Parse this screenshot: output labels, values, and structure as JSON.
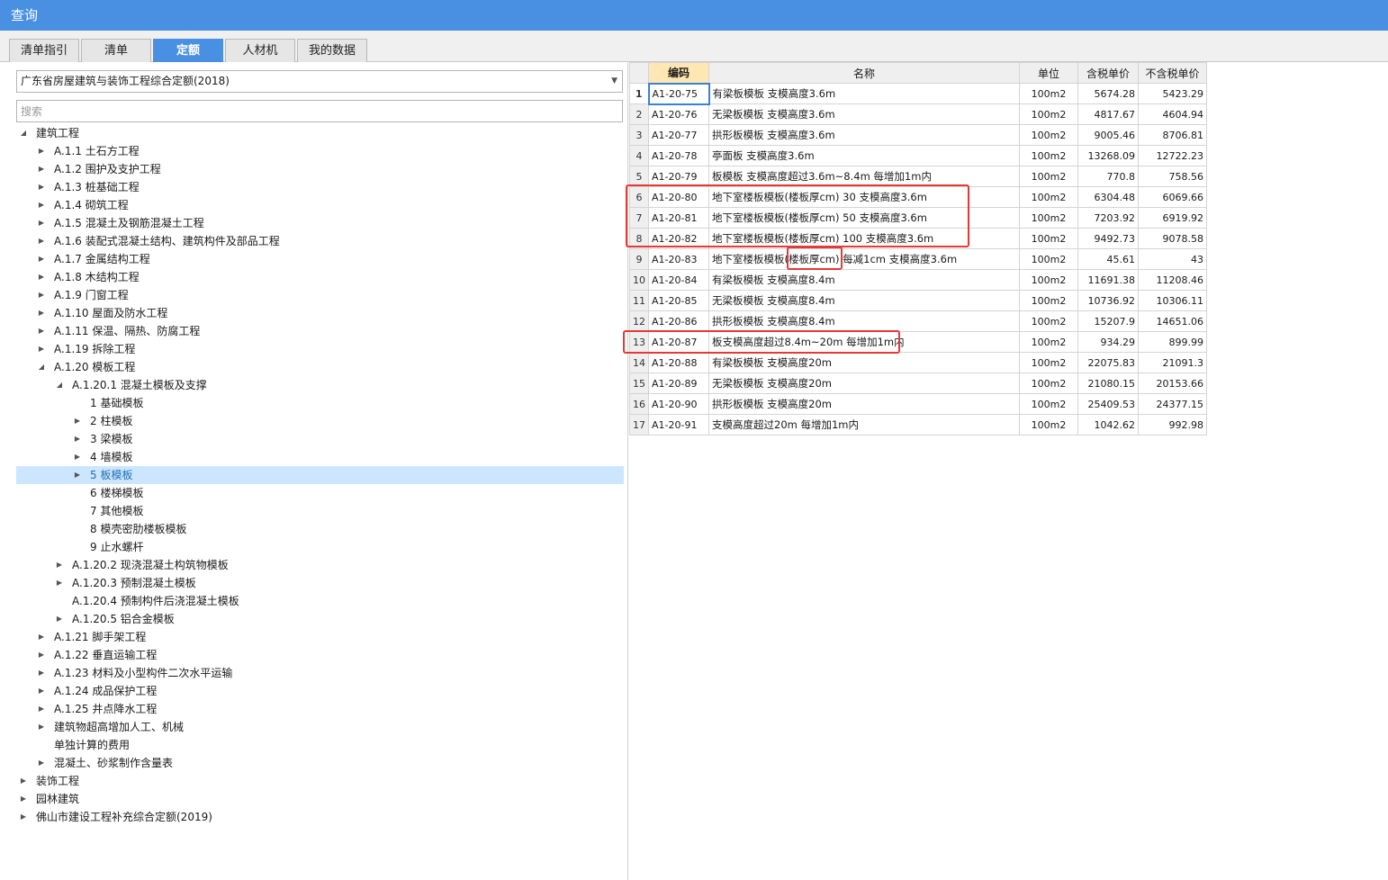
{
  "window": {
    "title": "查询"
  },
  "tabs": [
    {
      "label": "清单指引",
      "active": false
    },
    {
      "label": "清单",
      "active": false
    },
    {
      "label": "定额",
      "active": true
    },
    {
      "label": "人材机",
      "active": false
    },
    {
      "label": "我的数据",
      "active": false
    }
  ],
  "library_select": {
    "value": "广东省房屋建筑与装饰工程综合定额(2018)"
  },
  "search": {
    "placeholder": "搜索"
  },
  "tree": [
    {
      "label": "建筑工程",
      "level": 0,
      "toggle": "open"
    },
    {
      "label": "A.1.1 土石方工程",
      "level": 1,
      "toggle": "closed"
    },
    {
      "label": "A.1.2 围护及支护工程",
      "level": 1,
      "toggle": "closed"
    },
    {
      "label": "A.1.3 桩基础工程",
      "level": 1,
      "toggle": "closed"
    },
    {
      "label": "A.1.4 砌筑工程",
      "level": 1,
      "toggle": "closed"
    },
    {
      "label": "A.1.5 混凝土及钢筋混凝土工程",
      "level": 1,
      "toggle": "closed"
    },
    {
      "label": "A.1.6 装配式混凝土结构、建筑构件及部品工程",
      "level": 1,
      "toggle": "closed"
    },
    {
      "label": "A.1.7 金属结构工程",
      "level": 1,
      "toggle": "closed"
    },
    {
      "label": "A.1.8 木结构工程",
      "level": 1,
      "toggle": "closed"
    },
    {
      "label": "A.1.9 门窗工程",
      "level": 1,
      "toggle": "closed"
    },
    {
      "label": "A.1.10 屋面及防水工程",
      "level": 1,
      "toggle": "closed"
    },
    {
      "label": "A.1.11 保温、隔热、防腐工程",
      "level": 1,
      "toggle": "closed"
    },
    {
      "label": "A.1.19 拆除工程",
      "level": 1,
      "toggle": "closed"
    },
    {
      "label": "A.1.20 模板工程",
      "level": 1,
      "toggle": "open"
    },
    {
      "label": "A.1.20.1 混凝土模板及支撑",
      "level": 2,
      "toggle": "open"
    },
    {
      "label": "1 基础模板",
      "level": 3,
      "toggle": "none"
    },
    {
      "label": "2 柱模板",
      "level": 3,
      "toggle": "closed"
    },
    {
      "label": "3 梁模板",
      "level": 3,
      "toggle": "closed"
    },
    {
      "label": "4 墙模板",
      "level": 3,
      "toggle": "closed"
    },
    {
      "label": "5 板模板",
      "level": 3,
      "toggle": "closed",
      "selected": true
    },
    {
      "label": "6 楼梯模板",
      "level": 3,
      "toggle": "none"
    },
    {
      "label": "7 其他模板",
      "level": 3,
      "toggle": "none"
    },
    {
      "label": "8 模壳密肋楼板模板",
      "level": 3,
      "toggle": "none"
    },
    {
      "label": "9 止水螺杆",
      "level": 3,
      "toggle": "none"
    },
    {
      "label": "A.1.20.2 现浇混凝土构筑物模板",
      "level": 2,
      "toggle": "closed"
    },
    {
      "label": "A.1.20.3 预制混凝土模板",
      "level": 2,
      "toggle": "closed"
    },
    {
      "label": "A.1.20.4 预制构件后浇混凝土模板",
      "level": 2,
      "toggle": "none"
    },
    {
      "label": "A.1.20.5 铝合金模板",
      "level": 2,
      "toggle": "closed"
    },
    {
      "label": "A.1.21 脚手架工程",
      "level": 1,
      "toggle": "closed"
    },
    {
      "label": "A.1.22 垂直运输工程",
      "level": 1,
      "toggle": "closed"
    },
    {
      "label": "A.1.23 材料及小型构件二次水平运输",
      "level": 1,
      "toggle": "closed"
    },
    {
      "label": "A.1.24 成品保护工程",
      "level": 1,
      "toggle": "closed"
    },
    {
      "label": "A.1.25 井点降水工程",
      "level": 1,
      "toggle": "closed"
    },
    {
      "label": "建筑物超高增加人工、机械",
      "level": 1,
      "toggle": "closed"
    },
    {
      "label": "单独计算的费用",
      "level": 1,
      "toggle": "none"
    },
    {
      "label": "混凝土、砂浆制作含量表",
      "level": 1,
      "toggle": "closed"
    },
    {
      "label": "装饰工程",
      "level": 0,
      "toggle": "closed"
    },
    {
      "label": "园林建筑",
      "level": 0,
      "toggle": "closed"
    },
    {
      "label": "佛山市建设工程补充综合定额(2019)",
      "level": 0,
      "toggle": "closed"
    }
  ],
  "table": {
    "headers": {
      "code": "编码",
      "name": "名称",
      "unit": "单位",
      "price_tax": "含税单价",
      "price_notax": "不含税单价"
    },
    "rows": [
      {
        "no": "1",
        "code": "A1-20-75",
        "name": "有梁板模板 支模高度3.6m",
        "unit": "100m2",
        "price_tax": "5674.28",
        "price_notax": "5423.29"
      },
      {
        "no": "2",
        "code": "A1-20-76",
        "name": "无梁板模板 支模高度3.6m",
        "unit": "100m2",
        "price_tax": "4817.67",
        "price_notax": "4604.94"
      },
      {
        "no": "3",
        "code": "A1-20-77",
        "name": "拱形板模板 支模高度3.6m",
        "unit": "100m2",
        "price_tax": "9005.46",
        "price_notax": "8706.81"
      },
      {
        "no": "4",
        "code": "A1-20-78",
        "name": "亭面板 支模高度3.6m",
        "unit": "100m2",
        "price_tax": "13268.09",
        "price_notax": "12722.23"
      },
      {
        "no": "5",
        "code": "A1-20-79",
        "name": "板模板 支模高度超过3.6m~8.4m 每增加1m内",
        "unit": "100m2",
        "price_tax": "770.8",
        "price_notax": "758.56"
      },
      {
        "no": "6",
        "code": "A1-20-80",
        "name": "地下室楼板模板(楼板厚cm) 30 支模高度3.6m",
        "unit": "100m2",
        "price_tax": "6304.48",
        "price_notax": "6069.66"
      },
      {
        "no": "7",
        "code": "A1-20-81",
        "name": "地下室楼板模板(楼板厚cm) 50 支模高度3.6m",
        "unit": "100m2",
        "price_tax": "7203.92",
        "price_notax": "6919.92"
      },
      {
        "no": "8",
        "code": "A1-20-82",
        "name": "地下室楼板模板(楼板厚cm) 100 支模高度3.6m",
        "unit": "100m2",
        "price_tax": "9492.73",
        "price_notax": "9078.58"
      },
      {
        "no": "9",
        "code": "A1-20-83",
        "name": "地下室楼板模板(楼板厚cm) 每减1cm 支模高度3.6m",
        "unit": "100m2",
        "price_tax": "45.61",
        "price_notax": "43"
      },
      {
        "no": "10",
        "code": "A1-20-84",
        "name": "有梁板模板 支模高度8.4m",
        "unit": "100m2",
        "price_tax": "11691.38",
        "price_notax": "11208.46"
      },
      {
        "no": "11",
        "code": "A1-20-85",
        "name": "无梁板模板 支模高度8.4m",
        "unit": "100m2",
        "price_tax": "10736.92",
        "price_notax": "10306.11"
      },
      {
        "no": "12",
        "code": "A1-20-86",
        "name": "拱形板模板 支模高度8.4m",
        "unit": "100m2",
        "price_tax": "15207.9",
        "price_notax": "14651.06"
      },
      {
        "no": "13",
        "code": "A1-20-87",
        "name": "板支模高度超过8.4m~20m 每增加1m内",
        "unit": "100m2",
        "price_tax": "934.29",
        "price_notax": "899.99"
      },
      {
        "no": "14",
        "code": "A1-20-88",
        "name": "有梁板模板 支模高度20m",
        "unit": "100m2",
        "price_tax": "22075.83",
        "price_notax": "21091.3"
      },
      {
        "no": "15",
        "code": "A1-20-89",
        "name": "无梁板模板 支模高度20m",
        "unit": "100m2",
        "price_tax": "21080.15",
        "price_notax": "20153.66"
      },
      {
        "no": "16",
        "code": "A1-20-90",
        "name": "拱形板模板 支模高度20m",
        "unit": "100m2",
        "price_tax": "25409.53",
        "price_notax": "24377.15"
      },
      {
        "no": "17",
        "code": "A1-20-91",
        "name": "支模高度超过20m 每增加1m内",
        "unit": "100m2",
        "price_tax": "1042.62",
        "price_notax": "992.98"
      }
    ]
  },
  "colors": {
    "accent": "#4a90e2",
    "selection": "#cce6ff",
    "annotation": "#e53935",
    "header_active": "#ffe7b3"
  }
}
